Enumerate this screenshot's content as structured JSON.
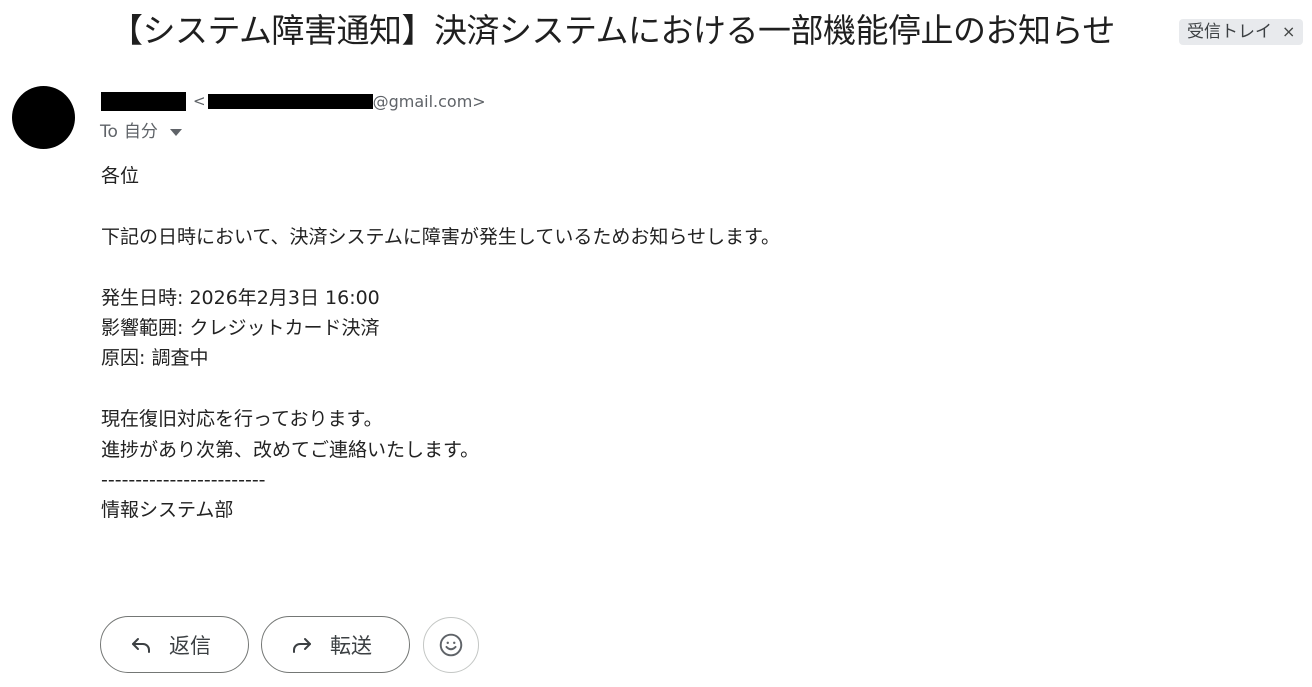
{
  "header": {
    "subject": "【システム障害通知】決済システムにおける一部機能停止のお知らせ",
    "label_chip": {
      "label": "受信トレイ",
      "remove": "×"
    }
  },
  "sender": {
    "email_open": "<",
    "email_domain": "@gmail.com>",
    "to_prefix": "To",
    "to_name": "自分"
  },
  "body": {
    "lines": [
      "各位",
      "",
      "下記の日時において、決済システムに障害が発生しているためお知らせします。",
      "",
      "発生日時: 2026年2月3日 16:00",
      "影響範囲: クレジットカード決済",
      "原因: 調査中",
      "",
      "現在復旧対応を行っております。",
      "進捗があり次第、改めてご連絡いたします。",
      "------------------------",
      "情報システム部"
    ]
  },
  "actions": {
    "reply_label": "返信",
    "forward_label": "転送"
  },
  "icons": {
    "reply": "reply-icon",
    "forward": "forward-icon",
    "emoji": "emoji-icon",
    "dropdown": "chevron-down-icon"
  }
}
